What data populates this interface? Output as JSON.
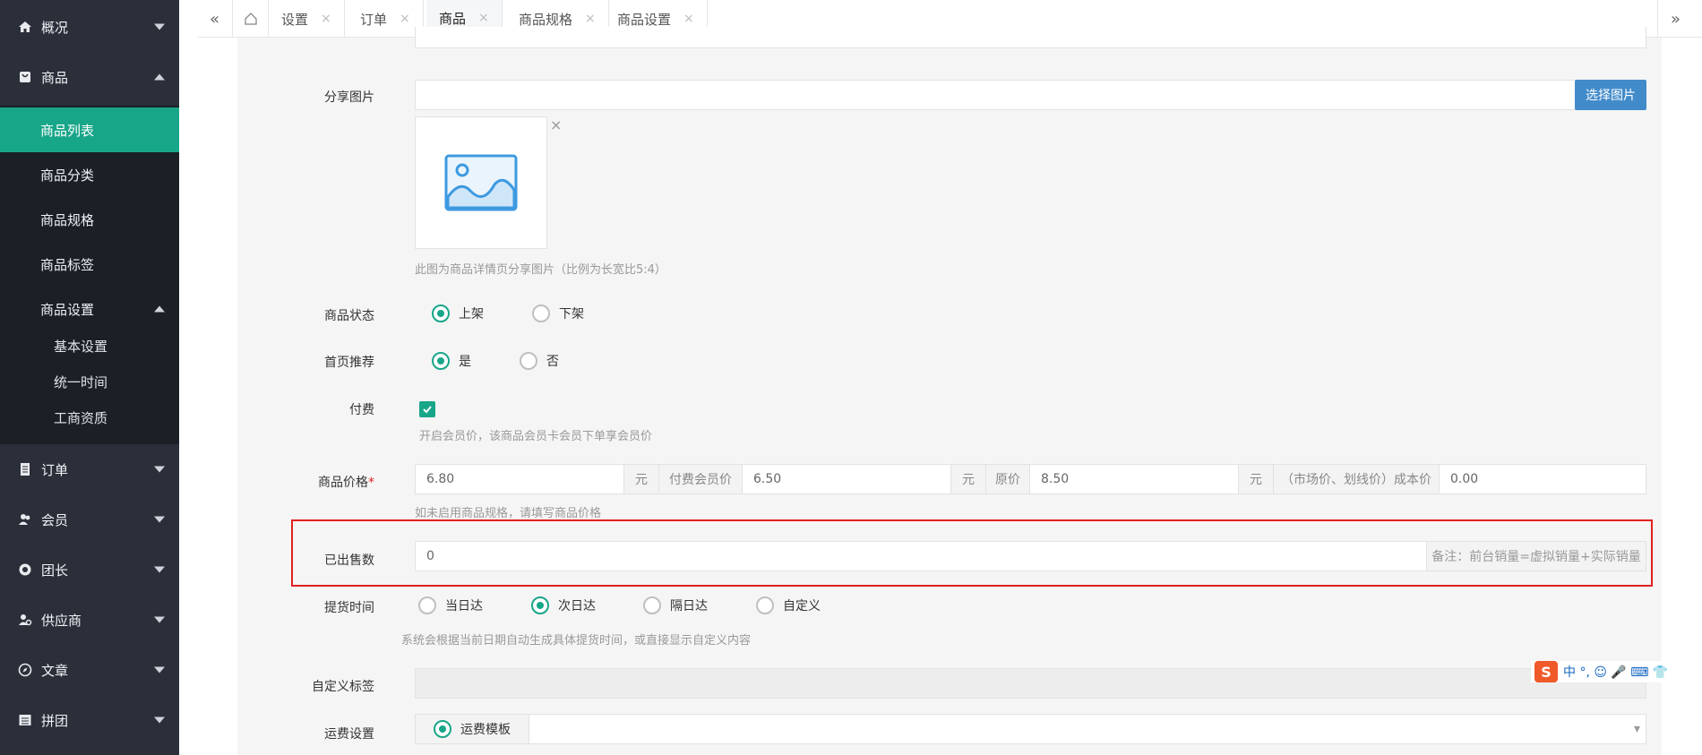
{
  "sidebar": {
    "items": [
      {
        "label": "概况",
        "icon": "home-icon"
      },
      {
        "label": "商品",
        "icon": "bag-icon"
      },
      {
        "label": "订单",
        "icon": "document-icon"
      },
      {
        "label": "会员",
        "icon": "user-icon"
      },
      {
        "label": "团长",
        "icon": "leader-icon"
      },
      {
        "label": "供应商",
        "icon": "supplier-icon"
      },
      {
        "label": "文章",
        "icon": "compass-icon"
      },
      {
        "label": "拼团",
        "icon": "group-icon"
      }
    ],
    "product_sub": [
      "商品列表",
      "商品分类",
      "商品规格",
      "商品标签",
      "商品设置"
    ],
    "settings_sub": [
      "基本设置",
      "统一时间",
      "工商资质"
    ]
  },
  "tabs": [
    "设置",
    "订单",
    "商品",
    "商品规格",
    "商品设置"
  ],
  "form": {
    "share_image": {
      "label": "分享图片",
      "button": "选择图片",
      "close": "×",
      "hint": "此图为商品详情页分享图片（比例为长宽比5:4）"
    },
    "status": {
      "label": "商品状态",
      "options": [
        "上架",
        "下架"
      ],
      "selected": "上架"
    },
    "home_recommend": {
      "label": "首页推荐",
      "options": [
        "是",
        "否"
      ],
      "selected": "是"
    },
    "paid": {
      "label": "付费",
      "checked": true,
      "hint": "开启会员价，该商品会员卡会员下单享会员价"
    },
    "price": {
      "label": "商品价格",
      "required_mark": "*",
      "price": "6.80",
      "unit": "元",
      "member_label": "付费会员价",
      "member_price": "6.50",
      "original_label": "原价",
      "original_price": "8.50",
      "cost_label": "（市场价、划线价）成本价",
      "cost_price": "0.00",
      "hint": "如未启用商品规格，请填写商品价格"
    },
    "sold": {
      "label": "已出售数",
      "value": "0",
      "note": "备注：前台销量=虚拟销量+实际销量"
    },
    "pickup": {
      "label": "提货时间",
      "options": [
        "当日达",
        "次日达",
        "隔日达",
        "自定义"
      ],
      "selected": "次日达",
      "hint": "系统会根据当前日期自动生成具体提货时间，或直接显示自定义内容"
    },
    "custom_tag": {
      "label": "自定义标签"
    },
    "shipping": {
      "label": "运费设置",
      "option": "运费模板",
      "selected": true
    }
  },
  "ime": {
    "logo": "S",
    "text": "中 °, ☺ 🎤 ⌨ 👕"
  },
  "colors": {
    "accent": "#18a689",
    "sidebar": "#2b2f3a",
    "button": "#428bca",
    "highlight": "#e0201f"
  }
}
